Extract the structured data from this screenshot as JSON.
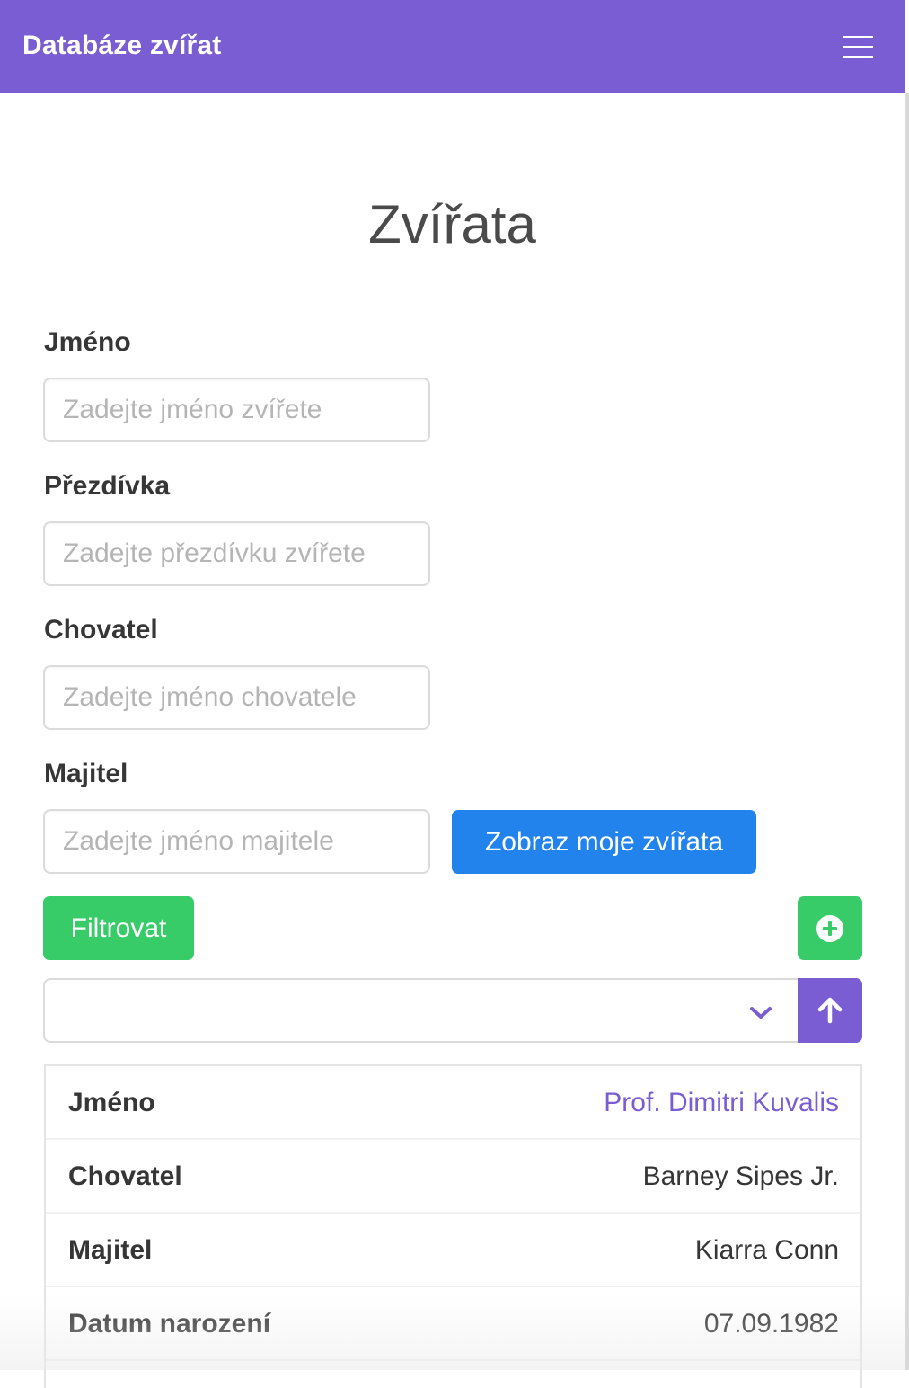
{
  "navbar": {
    "brand": "Databáze zvířat",
    "menu_icon": "hamburger-menu-icon"
  },
  "page": {
    "title": "Zvířata"
  },
  "filters": {
    "name": {
      "label": "Jméno",
      "placeholder": "Zadejte jméno zvířete",
      "value": ""
    },
    "nickname": {
      "label": "Přezdívka",
      "placeholder": "Zadejte přezdívku zvířete",
      "value": ""
    },
    "breeder": {
      "label": "Chovatel",
      "placeholder": "Zadejte jméno chovatele",
      "value": ""
    },
    "owner": {
      "label": "Majitel",
      "placeholder": "Zadejte jméno majitele",
      "value": ""
    },
    "show_mine_label": "Zobraz moje zvířata",
    "filter_label": "Filtrovat",
    "add_icon": "plus-circle-icon",
    "sort_select_value": "",
    "sort_direction_icon": "arrow-up-icon"
  },
  "colors": {
    "primary": "#7a5cd3",
    "info": "#2383ec",
    "success": "#37cc67"
  },
  "animal_card": {
    "rows": [
      {
        "key": "Jméno",
        "value": "Prof. Dimitri Kuvalis"
      },
      {
        "key": "Chovatel",
        "value": "Barney Sipes Jr."
      },
      {
        "key": "Majitel",
        "value": "Kiarra Conn"
      },
      {
        "key": "Datum narození",
        "value": "07.09.1982"
      }
    ]
  }
}
